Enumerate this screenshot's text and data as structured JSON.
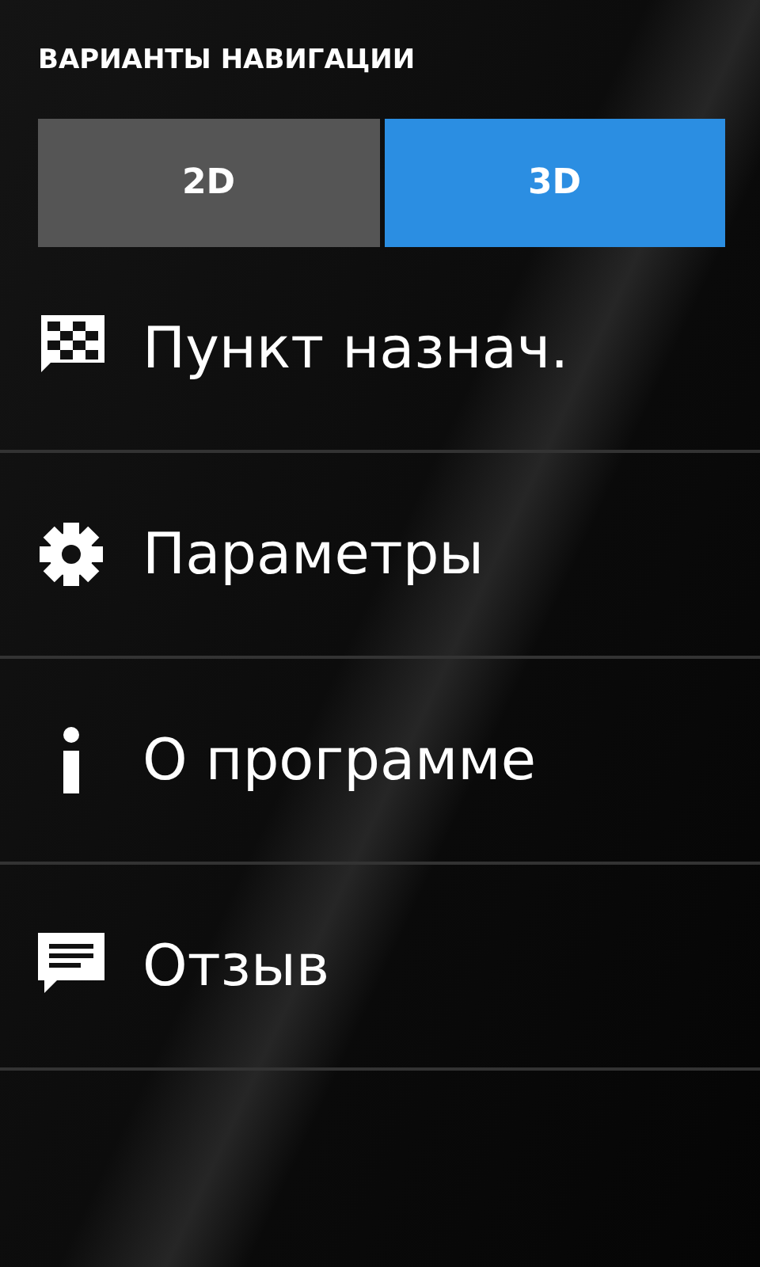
{
  "header": {
    "title": "ВАРИАНТЫ НАВИГАЦИИ"
  },
  "mode_toggle": [
    {
      "label": "2D",
      "selected": false
    },
    {
      "label": "3D",
      "selected": true
    }
  ],
  "menu": [
    {
      "kind": "flag",
      "label": "Пункт назнач."
    },
    {
      "kind": "gear",
      "label": "Параметры"
    },
    {
      "kind": "info",
      "label": "О программе"
    },
    {
      "kind": "feedback",
      "label": "Отзыв"
    }
  ]
}
